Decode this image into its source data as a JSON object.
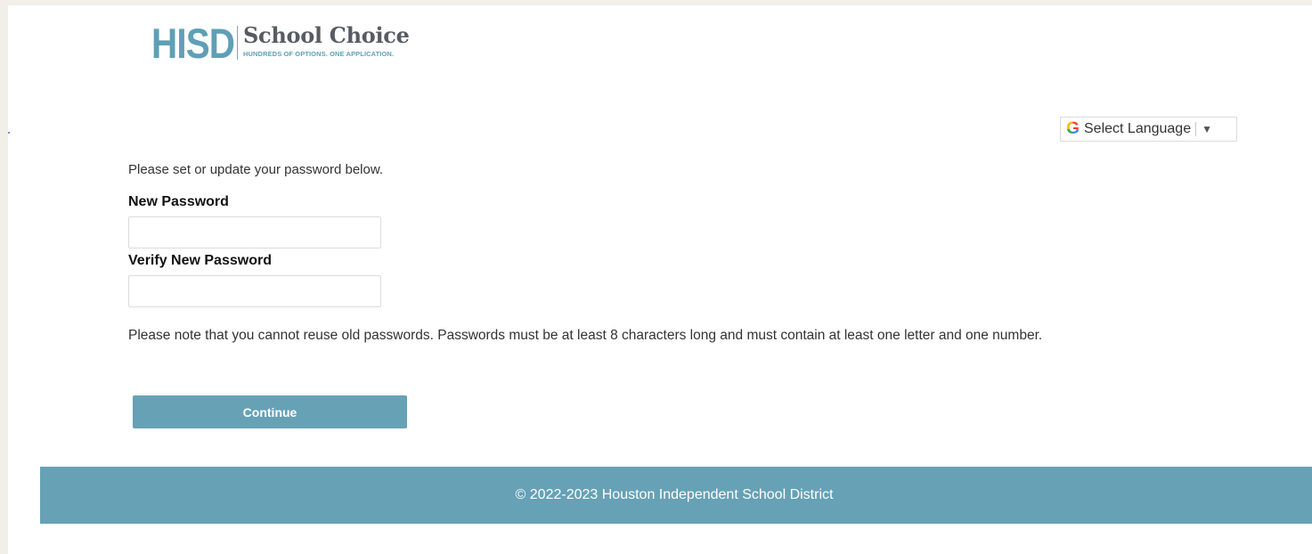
{
  "logo": {
    "mark": "HISD",
    "title": "School Choice",
    "tagline": "HUNDREDS OF OPTIONS. ONE APPLICATION."
  },
  "language_selector": {
    "icon": "google-g-icon",
    "label": "Select Language",
    "arrow": "▼"
  },
  "form": {
    "intro": "Please set or update your password below.",
    "new_password_label": "New Password",
    "new_password_value": "",
    "verify_password_label": "Verify New Password",
    "verify_password_value": "",
    "note": "Please note that you cannot reuse old passwords. Passwords must be at least 8 characters long and must contain at least one letter and one number.",
    "continue_label": "Continue"
  },
  "footer": {
    "text": "© 2022-2023 Houston Independent School District"
  },
  "colors": {
    "accent": "#66a1b6",
    "logo_blue": "#5f9fb6",
    "outer_background": "#f2efe9"
  }
}
